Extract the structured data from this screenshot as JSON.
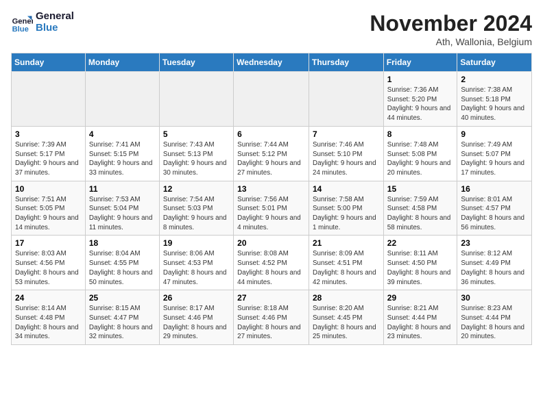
{
  "header": {
    "logo_line1": "General",
    "logo_line2": "Blue",
    "month_title": "November 2024",
    "location": "Ath, Wallonia, Belgium"
  },
  "weekdays": [
    "Sunday",
    "Monday",
    "Tuesday",
    "Wednesday",
    "Thursday",
    "Friday",
    "Saturday"
  ],
  "weeks": [
    [
      {
        "day": "",
        "info": ""
      },
      {
        "day": "",
        "info": ""
      },
      {
        "day": "",
        "info": ""
      },
      {
        "day": "",
        "info": ""
      },
      {
        "day": "",
        "info": ""
      },
      {
        "day": "1",
        "info": "Sunrise: 7:36 AM\nSunset: 5:20 PM\nDaylight: 9 hours and 44 minutes."
      },
      {
        "day": "2",
        "info": "Sunrise: 7:38 AM\nSunset: 5:18 PM\nDaylight: 9 hours and 40 minutes."
      }
    ],
    [
      {
        "day": "3",
        "info": "Sunrise: 7:39 AM\nSunset: 5:17 PM\nDaylight: 9 hours and 37 minutes."
      },
      {
        "day": "4",
        "info": "Sunrise: 7:41 AM\nSunset: 5:15 PM\nDaylight: 9 hours and 33 minutes."
      },
      {
        "day": "5",
        "info": "Sunrise: 7:43 AM\nSunset: 5:13 PM\nDaylight: 9 hours and 30 minutes."
      },
      {
        "day": "6",
        "info": "Sunrise: 7:44 AM\nSunset: 5:12 PM\nDaylight: 9 hours and 27 minutes."
      },
      {
        "day": "7",
        "info": "Sunrise: 7:46 AM\nSunset: 5:10 PM\nDaylight: 9 hours and 24 minutes."
      },
      {
        "day": "8",
        "info": "Sunrise: 7:48 AM\nSunset: 5:08 PM\nDaylight: 9 hours and 20 minutes."
      },
      {
        "day": "9",
        "info": "Sunrise: 7:49 AM\nSunset: 5:07 PM\nDaylight: 9 hours and 17 minutes."
      }
    ],
    [
      {
        "day": "10",
        "info": "Sunrise: 7:51 AM\nSunset: 5:05 PM\nDaylight: 9 hours and 14 minutes."
      },
      {
        "day": "11",
        "info": "Sunrise: 7:53 AM\nSunset: 5:04 PM\nDaylight: 9 hours and 11 minutes."
      },
      {
        "day": "12",
        "info": "Sunrise: 7:54 AM\nSunset: 5:03 PM\nDaylight: 9 hours and 8 minutes."
      },
      {
        "day": "13",
        "info": "Sunrise: 7:56 AM\nSunset: 5:01 PM\nDaylight: 9 hours and 4 minutes."
      },
      {
        "day": "14",
        "info": "Sunrise: 7:58 AM\nSunset: 5:00 PM\nDaylight: 9 hours and 1 minute."
      },
      {
        "day": "15",
        "info": "Sunrise: 7:59 AM\nSunset: 4:58 PM\nDaylight: 8 hours and 58 minutes."
      },
      {
        "day": "16",
        "info": "Sunrise: 8:01 AM\nSunset: 4:57 PM\nDaylight: 8 hours and 56 minutes."
      }
    ],
    [
      {
        "day": "17",
        "info": "Sunrise: 8:03 AM\nSunset: 4:56 PM\nDaylight: 8 hours and 53 minutes."
      },
      {
        "day": "18",
        "info": "Sunrise: 8:04 AM\nSunset: 4:55 PM\nDaylight: 8 hours and 50 minutes."
      },
      {
        "day": "19",
        "info": "Sunrise: 8:06 AM\nSunset: 4:53 PM\nDaylight: 8 hours and 47 minutes."
      },
      {
        "day": "20",
        "info": "Sunrise: 8:08 AM\nSunset: 4:52 PM\nDaylight: 8 hours and 44 minutes."
      },
      {
        "day": "21",
        "info": "Sunrise: 8:09 AM\nSunset: 4:51 PM\nDaylight: 8 hours and 42 minutes."
      },
      {
        "day": "22",
        "info": "Sunrise: 8:11 AM\nSunset: 4:50 PM\nDaylight: 8 hours and 39 minutes."
      },
      {
        "day": "23",
        "info": "Sunrise: 8:12 AM\nSunset: 4:49 PM\nDaylight: 8 hours and 36 minutes."
      }
    ],
    [
      {
        "day": "24",
        "info": "Sunrise: 8:14 AM\nSunset: 4:48 PM\nDaylight: 8 hours and 34 minutes."
      },
      {
        "day": "25",
        "info": "Sunrise: 8:15 AM\nSunset: 4:47 PM\nDaylight: 8 hours and 32 minutes."
      },
      {
        "day": "26",
        "info": "Sunrise: 8:17 AM\nSunset: 4:46 PM\nDaylight: 8 hours and 29 minutes."
      },
      {
        "day": "27",
        "info": "Sunrise: 8:18 AM\nSunset: 4:46 PM\nDaylight: 8 hours and 27 minutes."
      },
      {
        "day": "28",
        "info": "Sunrise: 8:20 AM\nSunset: 4:45 PM\nDaylight: 8 hours and 25 minutes."
      },
      {
        "day": "29",
        "info": "Sunrise: 8:21 AM\nSunset: 4:44 PM\nDaylight: 8 hours and 23 minutes."
      },
      {
        "day": "30",
        "info": "Sunrise: 8:23 AM\nSunset: 4:44 PM\nDaylight: 8 hours and 20 minutes."
      }
    ]
  ]
}
